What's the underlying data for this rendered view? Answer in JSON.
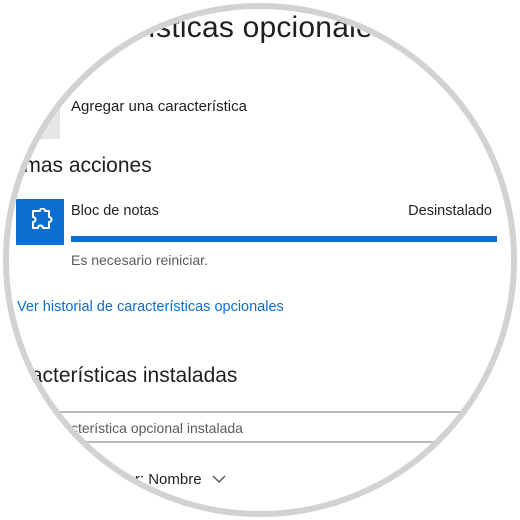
{
  "page": {
    "title": "Características opcionales",
    "add_feature_label": "Agregar una característica"
  },
  "recent": {
    "heading": "Últimas acciones",
    "item": {
      "name": "Bloc de notas",
      "status": "Desinstalado",
      "progress_percent": 100,
      "note": "Es necesario reiniciar.",
      "icon": "puzzle-icon"
    },
    "history_link": "Ver historial de características opcionales"
  },
  "installed": {
    "heading": "Características instaladas",
    "search_placeholder": "Buscar una característica opcional instalada",
    "sort_label": "Ordenar por: Nombre"
  },
  "colors": {
    "accent": "#0a6fd1",
    "ring": "#d2d2d2"
  }
}
